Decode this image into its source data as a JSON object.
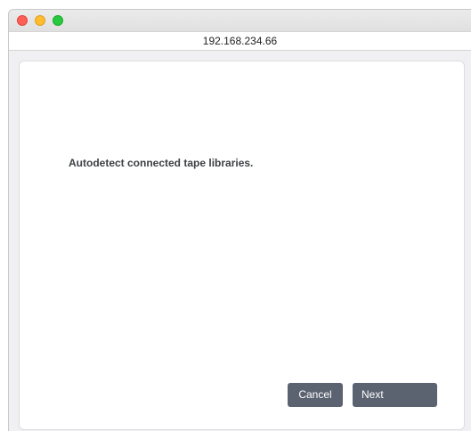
{
  "window": {
    "address": "192.168.234.66"
  },
  "dialog": {
    "message": "Autodetect connected tape libraries.",
    "cancel_label": "Cancel",
    "next_label": "Next"
  },
  "colors": {
    "button_bg": "#5b6270",
    "message_text": "#3e4045",
    "traffic_close": "#fd5f57",
    "traffic_minimize": "#febc2e",
    "traffic_zoom": "#28c840"
  }
}
